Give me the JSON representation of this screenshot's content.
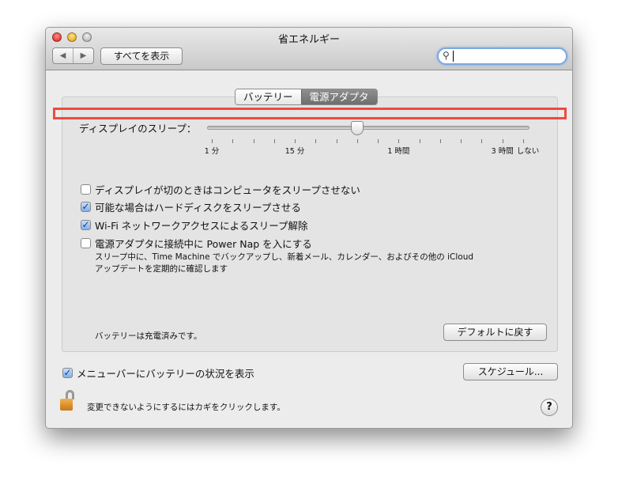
{
  "window": {
    "title": "省エネルギー"
  },
  "toolbar": {
    "back": "◀",
    "forward": "▶",
    "show_all": "すべてを表示",
    "search_value": "",
    "search_icon": "magnifier"
  },
  "tabs": [
    {
      "label": "バッテリー",
      "selected": false
    },
    {
      "label": "電源アダプタ",
      "selected": true
    }
  ],
  "display_sleep": {
    "label": "ディスプレイのスリープ：",
    "tick_count": 16,
    "value_tick_index": 7,
    "tick_labels": [
      {
        "text": "1 分",
        "tick": 0
      },
      {
        "text": "15 分",
        "tick": 4
      },
      {
        "text": "1 時間",
        "tick": 9
      },
      {
        "text": "3 時間",
        "tick": 14
      },
      {
        "text": "しない",
        "tick": 15
      }
    ]
  },
  "options": [
    {
      "label": "ディスプレイが切のときはコンピュータをスリープさせない",
      "checked": false
    },
    {
      "label": "可能な場合はハードディスクをスリープさせる",
      "checked": true
    },
    {
      "label": "Wi-Fi ネットワークアクセスによるスリープ解除",
      "checked": true
    },
    {
      "label": "電源アダプタに接続中に Power Nap を入にする",
      "checked": false
    }
  ],
  "power_nap_note": [
    "スリープ中に、Time Machine でバックアップし、新着メール、カレンダー、およびその他の iCloud",
    "アップデートを定期的に確認します"
  ],
  "battery_status": "バッテリーは充電済みです。",
  "restore_defaults": "デフォルトに戻す",
  "show_battery_menu": {
    "label": "メニューバーにバッテリーの状況を表示",
    "checked": true
  },
  "schedule": "スケジュール...",
  "lock_text": "変更できないようにするにはカギをクリックします。",
  "help": "?"
}
